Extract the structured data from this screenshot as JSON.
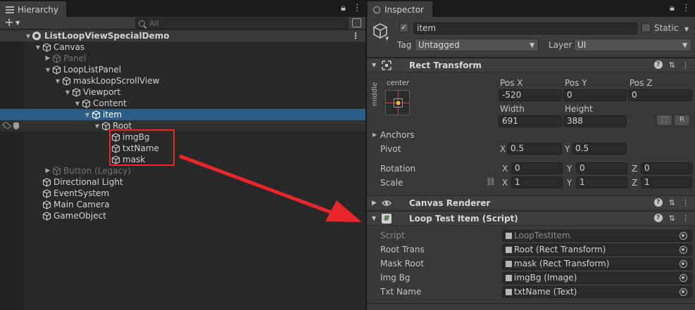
{
  "hierarchy": {
    "tab_label": "Hierarchy",
    "search_placeholder": "All",
    "scene_name": "ListLoopViewSpecialDemo",
    "items": [
      {
        "label": "Canvas"
      },
      {
        "label": "Panel"
      },
      {
        "label": "LoopListPanel"
      },
      {
        "label": "maskLoopScrollView"
      },
      {
        "label": "Viewport"
      },
      {
        "label": "Content"
      },
      {
        "label": "item"
      },
      {
        "label": "Root"
      },
      {
        "label": "imgBg"
      },
      {
        "label": "txtName"
      },
      {
        "label": "mask"
      },
      {
        "label": "Button (Legacy)"
      },
      {
        "label": "Directional Light"
      },
      {
        "label": "EventSystem"
      },
      {
        "label": "Main Camera"
      },
      {
        "label": "GameObject"
      }
    ]
  },
  "inspector": {
    "tab_label": "Inspector",
    "object_name": "item",
    "static_label": "Static",
    "tag_label": "Tag",
    "tag_value": "Untagged",
    "layer_label": "Layer",
    "layer_value": "UI",
    "rect_transform": {
      "title": "Rect Transform",
      "anchor_h": "center",
      "anchor_v": "middle",
      "pos_x_label": "Pos X",
      "pos_x": "-520",
      "pos_y_label": "Pos Y",
      "pos_y": "0",
      "pos_z_label": "Pos Z",
      "pos_z": "0",
      "width_label": "Width",
      "width": "691",
      "height_label": "Height",
      "height": "388",
      "r_button": "R",
      "anchors_label": "Anchors",
      "pivot_label": "Pivot",
      "pivot_x": "0.5",
      "pivot_y": "0.5",
      "rotation_label": "Rotation",
      "rot_x": "0",
      "rot_y": "0",
      "rot_z": "0",
      "scale_label": "Scale",
      "scale_x": "1",
      "scale_y": "1",
      "scale_z": "1",
      "x_label": "X",
      "y_label": "Y",
      "z_label": "Z"
    },
    "canvas_renderer": {
      "title": "Canvas Renderer"
    },
    "loop_item": {
      "title": "Loop Test Item (Script)",
      "script_label": "Script",
      "script_value": "LoopTestItem",
      "root_label": "Root Trans",
      "root_value": "Root (Rect Transform)",
      "mask_label": "Mask Root",
      "mask_value": "mask (Rect Transform)",
      "img_label": "Img Bg",
      "img_value": "imgBg (Image)",
      "txt_label": "Txt Name",
      "txt_value": "txtName (Text)"
    }
  },
  "colors": {
    "selection": "#2c5d87",
    "annotation_red": "#e8262b",
    "panel_dark": "#282828",
    "inspector_bg": "#383838"
  }
}
